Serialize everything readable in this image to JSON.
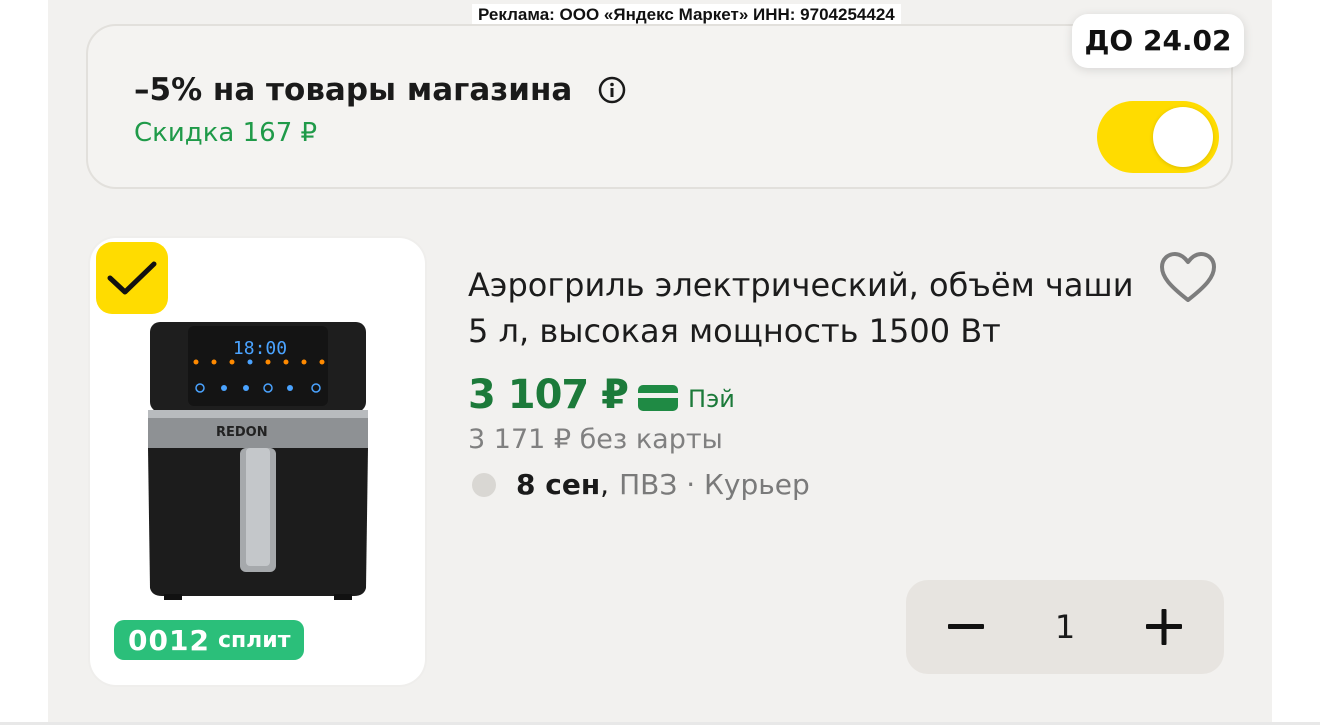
{
  "ad_label": "Реклама: ООО «Яндекс Маркет» ИНН: 9704254424",
  "promo": {
    "title": "–5% на товары магазина",
    "subtitle": "Скидка 167 ₽",
    "date_badge": "ДО 24.02",
    "toggle_on": true,
    "info_icon": "info-icon"
  },
  "product": {
    "title": "Аэрогриль электрический, объём чаши 5 л, высокая мощность 1500 Вт",
    "price": "3 107 ₽",
    "pay_label": "Пэй",
    "price_without_card": "3 171 ₽ без карты",
    "delivery": {
      "date": "8 сен",
      "separator": ",",
      "methods": "ПВЗ · Курьер"
    },
    "split": {
      "value": "0012",
      "label": "сплит"
    },
    "selected": true,
    "image": {
      "brand": "REDON",
      "display": "18:00"
    }
  },
  "stepper": {
    "minus": "−",
    "count": "1",
    "plus": "+"
  },
  "colors": {
    "accent_yellow": "#ffdc00",
    "discount_green": "#1f9a49",
    "price_green": "#1c7a3a",
    "split_green": "#2bbf7a"
  }
}
